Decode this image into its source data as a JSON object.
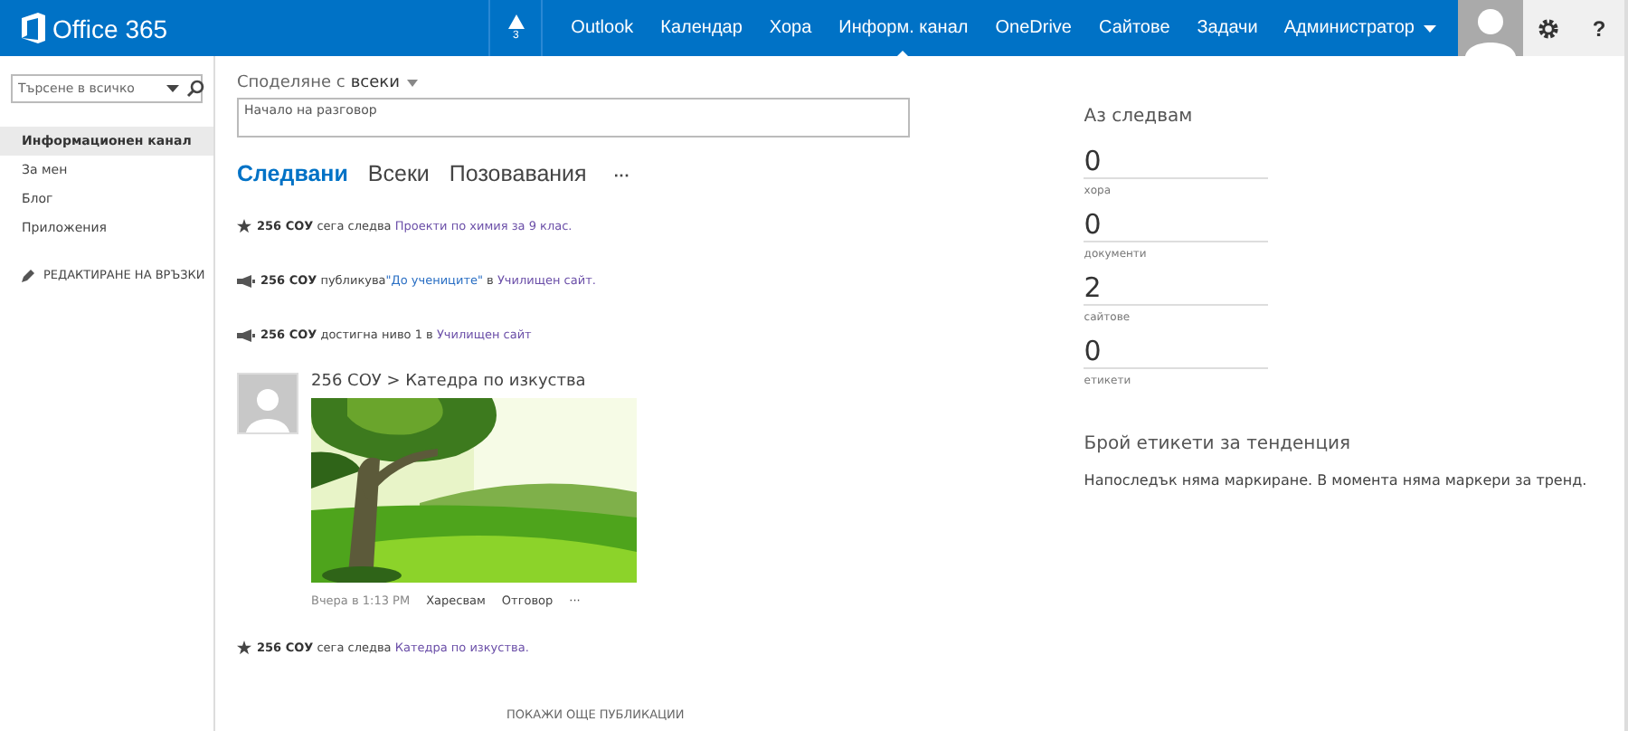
{
  "topbar": {
    "logo": "Office 365",
    "notifications": {
      "count": "3"
    },
    "nav": [
      {
        "label": "Outlook",
        "selected": false
      },
      {
        "label": "Календар",
        "selected": false
      },
      {
        "label": "Хора",
        "selected": false
      },
      {
        "label": "Информ. канал",
        "selected": true
      },
      {
        "label": "OneDrive",
        "selected": false
      },
      {
        "label": "Сайтове",
        "selected": false
      },
      {
        "label": "Задачи",
        "selected": false
      }
    ],
    "user": "Администратор",
    "help": "?"
  },
  "sidebar": {
    "search": {
      "placeholder": "Търсене в всичко"
    },
    "items": [
      {
        "label": "Информационен канал",
        "selected": true
      },
      {
        "label": "За мен",
        "selected": false
      },
      {
        "label": "Блог",
        "selected": false
      },
      {
        "label": "Приложения",
        "selected": false
      }
    ],
    "edit_links": "РЕДАКТИРАНЕ НА ВРЪЗКИ"
  },
  "share": {
    "label": "Споделяне с",
    "audience": "всеки",
    "placeholder": "Начало на разговор"
  },
  "tabs": [
    {
      "label": "Следвани",
      "selected": true
    },
    {
      "label": "Всеки",
      "selected": false
    },
    {
      "label": "Позовавания",
      "selected": false
    }
  ],
  "tabs_more": "···",
  "feed": [
    {
      "kind": "follow",
      "actor": "256 СОУ",
      "parts": [
        {
          "text": " сега следва ",
          "kind": "plain"
        },
        {
          "text": "Проекти по химия за 9 клас.",
          "kind": "link"
        }
      ]
    },
    {
      "kind": "publish",
      "actor": "256 СОУ",
      "parts": [
        {
          "text": " публикува",
          "kind": "plain"
        },
        {
          "text": "\"До учениците\"",
          "kind": "doc"
        },
        {
          "text": " в ",
          "kind": "plain"
        },
        {
          "text": "Училищен сайт.",
          "kind": "link"
        }
      ]
    },
    {
      "kind": "level",
      "actor": "256 СОУ",
      "parts": [
        {
          "text": " достигна ниво 1 в ",
          "kind": "plain"
        },
        {
          "text": "Училищен сайт",
          "kind": "link"
        }
      ]
    },
    {
      "kind": "post",
      "title": "256 СОУ > Катедра по изкуства",
      "time": "Вчера в 1:13 PM",
      "actions": [
        "Харесвам",
        "Отговор",
        "···"
      ]
    },
    {
      "kind": "follow",
      "actor": "256 СОУ",
      "parts": [
        {
          "text": " сега следва ",
          "kind": "plain"
        },
        {
          "text": "Катедра по изкуства.",
          "kind": "link"
        }
      ]
    }
  ],
  "more": "ПОКАЖИ ОЩЕ ПУБЛИКАЦИИ",
  "following": {
    "title": "Аз следвам",
    "stats": [
      {
        "value": "0",
        "label": "хора"
      },
      {
        "value": "0",
        "label": "документи"
      },
      {
        "value": "2",
        "label": "сайтове"
      },
      {
        "value": "0",
        "label": "етикети"
      }
    ]
  },
  "trending": {
    "title": "Брой етикети за тенденция",
    "text": "Напоследък няма маркиране. В момента няма маркери за тренд."
  }
}
